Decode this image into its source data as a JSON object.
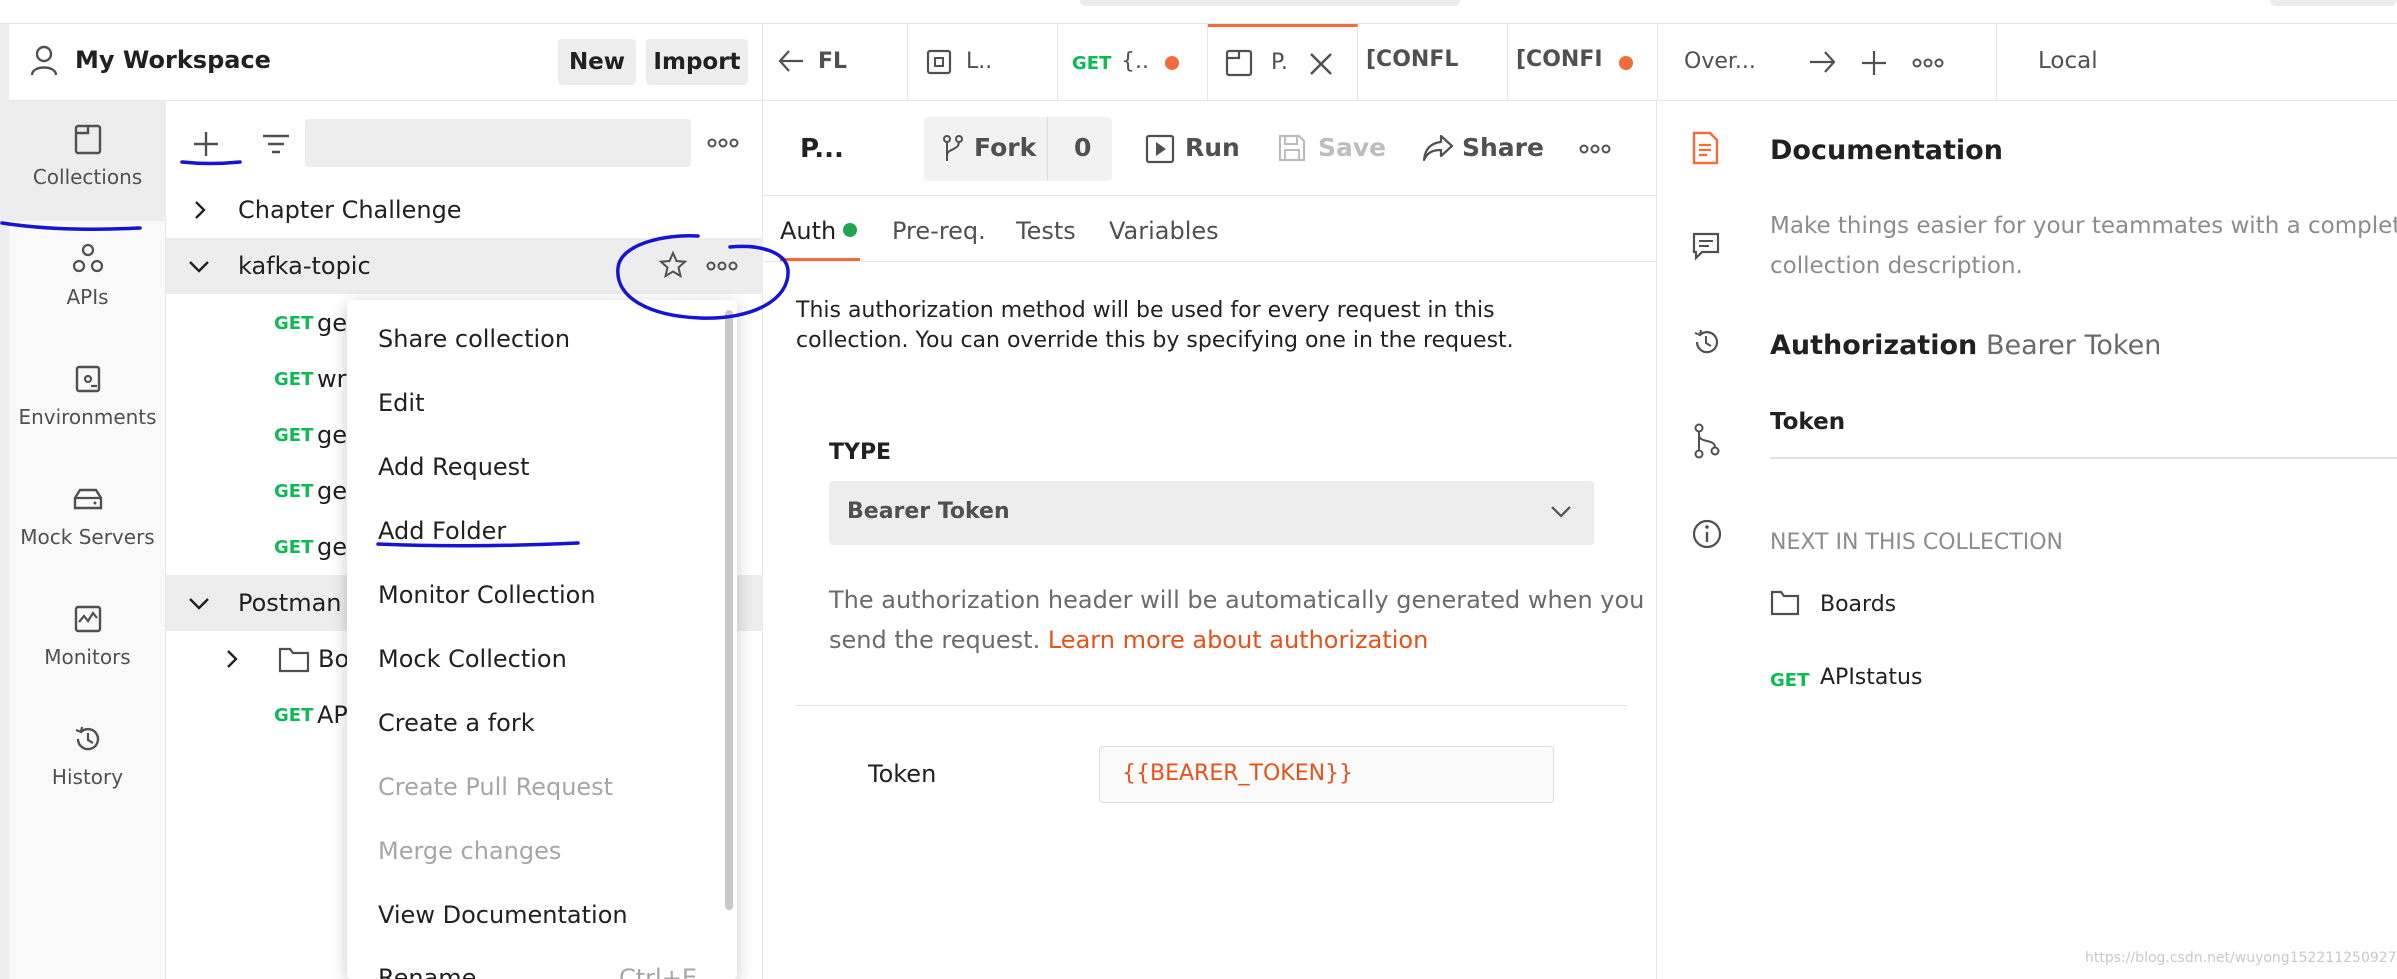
{
  "workspace": {
    "title": "My Workspace",
    "new_label": "New",
    "import_label": "Import"
  },
  "rail": [
    {
      "label": "Collections",
      "icon": "collections-icon",
      "active": true
    },
    {
      "label": "APIs",
      "icon": "apis-icon"
    },
    {
      "label": "Environments",
      "icon": "environments-icon"
    },
    {
      "label": "Mock Servers",
      "icon": "mock-servers-icon"
    },
    {
      "label": "Monitors",
      "icon": "monitors-icon"
    },
    {
      "label": "History",
      "icon": "history-icon"
    }
  ],
  "tree": {
    "chapter": "Chapter Challenge",
    "kafka": "kafka-topic",
    "kafka_requests": [
      {
        "method": "GET",
        "name": "ge"
      },
      {
        "method": "GET",
        "name": "wr"
      },
      {
        "method": "GET",
        "name": "ge"
      },
      {
        "method": "GET",
        "name": "ge"
      },
      {
        "method": "GET",
        "name": "ge"
      }
    ],
    "postman": "Postman",
    "boards_folder": "Bo",
    "api_req": {
      "method": "GET",
      "name": "AP"
    }
  },
  "context_menu": {
    "items": [
      "Share collection",
      "Edit",
      "Add Request",
      "Add Folder",
      "Monitor Collection",
      "Mock Collection",
      "Create a fork",
      "Create Pull Request",
      "Merge changes",
      "View Documentation",
      "Rename"
    ],
    "rename_shortcut": "Ctrl+E"
  },
  "tabs": {
    "t1": "FL",
    "t2": "L..",
    "t3_method": "GET",
    "t3": "{..",
    "t4": "P.",
    "t5": "[CONFL",
    "t6": "[CONFI",
    "t7": "Over...",
    "env": "Local"
  },
  "request": {
    "title": "P...",
    "fork": "Fork",
    "fork_count": "0",
    "run": "Run",
    "save": "Save",
    "share": "Share",
    "subtabs": [
      "Auth",
      "Pre-req.",
      "Tests",
      "Variables"
    ],
    "auth_desc1": "This authorization method will be used for every request in this",
    "auth_desc2": "collection. You can override this by specifying one in the request.",
    "type_label": "TYPE",
    "type_value": "Bearer Token",
    "note1": "The authorization header will be automatically generated when you",
    "note2": "send the request.",
    "note_link": "Learn more about authorization",
    "token_label": "Token",
    "token_value": "{{BEARER_TOKEN}}"
  },
  "doc": {
    "title": "Documentation",
    "desc1": "Make things easier for your teammates with a complete",
    "desc2": "collection description.",
    "auth_title": "Authorization",
    "auth_value": "Bearer Token",
    "token": "Token",
    "next_title": "NEXT IN THIS COLLECTION",
    "next_folder": "Boards",
    "next_req_method": "GET",
    "next_req": "APIstatus"
  },
  "watermark": "https://blog.csdn.net/wuyong152211250927",
  "colors": {
    "accent": "#f26b3a",
    "get": "#0cbb52",
    "annotation": "#1414d2",
    "success": "#20a650"
  }
}
